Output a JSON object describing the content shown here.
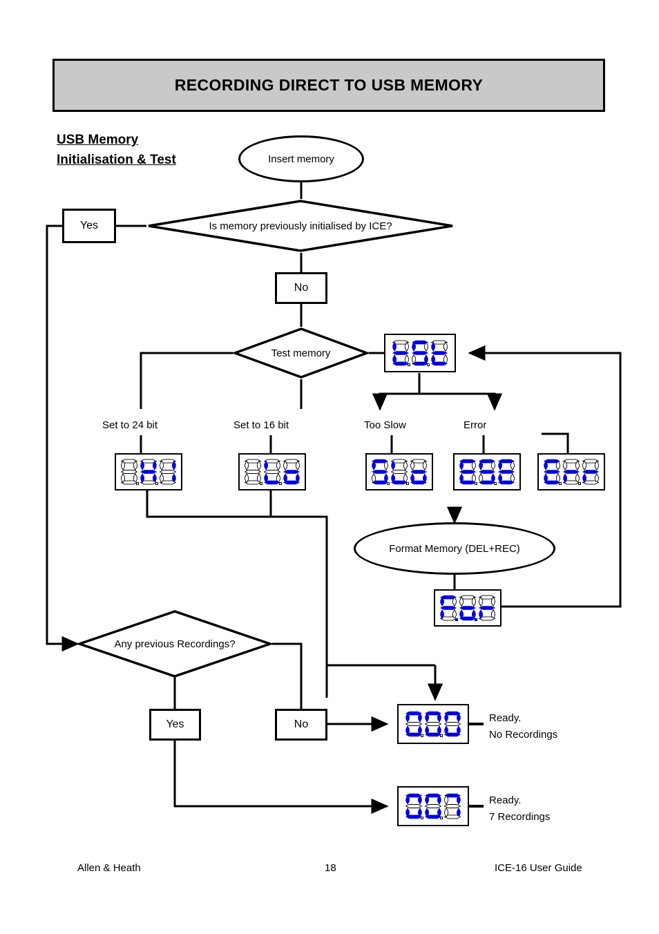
{
  "header": {
    "title": "RECORDING DIRECT TO USB MEMORY"
  },
  "section": {
    "line1": "USB Memory",
    "line2": "Initialisation & Test"
  },
  "nodes": {
    "insert_memory": "Insert memory",
    "yes_top": "Yes",
    "decision_initialised": "Is memory previously initialised by ICE?",
    "no_top": "No",
    "decision_test": "Test memory",
    "label_24bit": "Set to 24 bit",
    "label_16bit": "Set to 16 bit",
    "label_tooslow": "Too Slow",
    "label_error": "Error",
    "format_memory": "Format Memory (DEL+REC)",
    "decision_recordings": "Any previous Recordings?",
    "yes_bottom": "Yes",
    "no_bottom": "No"
  },
  "displays": {
    "tst": {
      "name": "tSt",
      "digits": [
        "t",
        "S",
        "t"
      ],
      "dp": [
        false,
        false,
        false
      ]
    },
    "hi": {
      "name": "Hi",
      "digits": [
        " ",
        "H",
        "i"
      ],
      "dp": [
        false,
        false,
        false
      ]
    },
    "lo": {
      "name": "Lo",
      "digits": [
        " ",
        "L",
        "o"
      ],
      "dp": [
        false,
        false,
        false
      ]
    },
    "slo": {
      "name": "SLo",
      "digits": [
        "S",
        "L",
        "o"
      ],
      "dp": [
        false,
        false,
        false
      ]
    },
    "err1": {
      "name": "ErR",
      "digits": [
        "E",
        "S",
        "E"
      ],
      "dp": [
        false,
        false,
        false
      ]
    },
    "err2": {
      "name": "Err",
      "digits": [
        "E",
        "r",
        "r"
      ],
      "dp": [
        false,
        false,
        false
      ]
    },
    "for": {
      "name": "For",
      "digits": [
        "F",
        "o",
        "r"
      ],
      "dp": [
        true,
        true,
        false
      ]
    },
    "zero": {
      "name": "000",
      "digits": [
        "0",
        "0",
        "0"
      ],
      "dp": [
        false,
        false,
        false
      ]
    },
    "seven": {
      "name": "007",
      "digits": [
        "0",
        "0",
        "7"
      ],
      "dp": [
        false,
        false,
        false
      ]
    }
  },
  "readouts": {
    "ready_none_l1": "Ready.",
    "ready_none_l2": "No Recordings",
    "ready_seven_l1": "Ready.",
    "ready_seven_l2": "7 Recordings"
  },
  "footer": {
    "left": "Allen & Heath",
    "page": "18",
    "right": "ICE-16  User Guide"
  },
  "colors": {
    "segment_on": "#0000e0",
    "segment_off": "#ffffff",
    "segment_edge": "#000000",
    "banner_fill": "#c9c9c9",
    "ink": "#000000"
  }
}
